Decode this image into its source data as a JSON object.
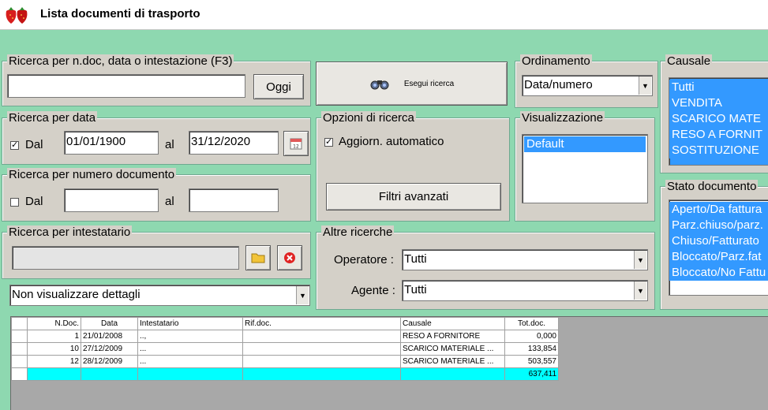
{
  "window": {
    "title": "Lista documenti di trasporto",
    "app_icon": "strawberry-icon"
  },
  "search_text": {
    "legend": "Ricerca per n.doc, data o intestazione (F3)",
    "value": "",
    "today_label": "Oggi"
  },
  "search_date": {
    "legend": "Ricerca per data",
    "checked": true,
    "from_label": "Dal",
    "from_value": "01/01/1900",
    "to_label": "al",
    "to_value": "31/12/2020",
    "calendar_icon": "calendar-icon"
  },
  "search_number": {
    "legend": "Ricerca per numero documento",
    "checked": false,
    "from_label": "Dal",
    "from_value": "",
    "to_label": "al",
    "to_value": ""
  },
  "search_holder": {
    "legend": "Ricerca per intestatario",
    "value": "",
    "folder_icon": "folder-icon",
    "clear_icon": "clear-red-icon"
  },
  "details_combo": {
    "value": "Non visualizzare dettagli"
  },
  "execute": {
    "label": "Esegui ricerca",
    "icon": "binoculars-icon"
  },
  "options": {
    "legend": "Opzioni di ricerca",
    "auto_update_label": "Aggiorn. automatico",
    "auto_update_checked": true,
    "advanced_filters_label": "Filtri avanzati"
  },
  "other_searches": {
    "legend": "Altre ricerche",
    "operator_label": "Operatore :",
    "operator_value": "Tutti",
    "agent_label": "Agente :",
    "agent_value": "Tutti"
  },
  "ordering": {
    "legend": "Ordinamento",
    "value": "Data/numero"
  },
  "view": {
    "legend": "Visualizzazione",
    "items": [
      "Default"
    ]
  },
  "causale": {
    "legend": "Causale",
    "items": [
      "Tutti",
      "VENDITA",
      "SCARICO MATE",
      "RESO A FORNIT",
      "SOSTITUZIONE"
    ]
  },
  "doc_state": {
    "legend": "Stato documento",
    "items": [
      "Aperto/Da fattura",
      "Parz.chiuso/parz.",
      "Chiuso/Fatturato",
      "Bloccato/Parz.fat",
      "Bloccato/No Fattu"
    ]
  },
  "table": {
    "headers": [
      "N.Doc.",
      "Data",
      "Intestatario",
      "Rif.doc.",
      "Causale",
      "Tot.doc."
    ],
    "rows": [
      [
        "1",
        "21/01/2008",
        "..,",
        "",
        "RESO A  FORNITORE",
        "0,000"
      ],
      [
        "10",
        "27/12/2009",
        "...",
        "",
        "SCARICO MATERIALE ...",
        "133,854"
      ],
      [
        "12",
        "28/12/2009",
        "...",
        "",
        "SCARICO MATERIALE ...",
        "503,557"
      ]
    ],
    "total": "637,411"
  },
  "colors": {
    "background": "#8ed8b0",
    "selection": "#3399ff",
    "total_row": "#00ffff"
  }
}
